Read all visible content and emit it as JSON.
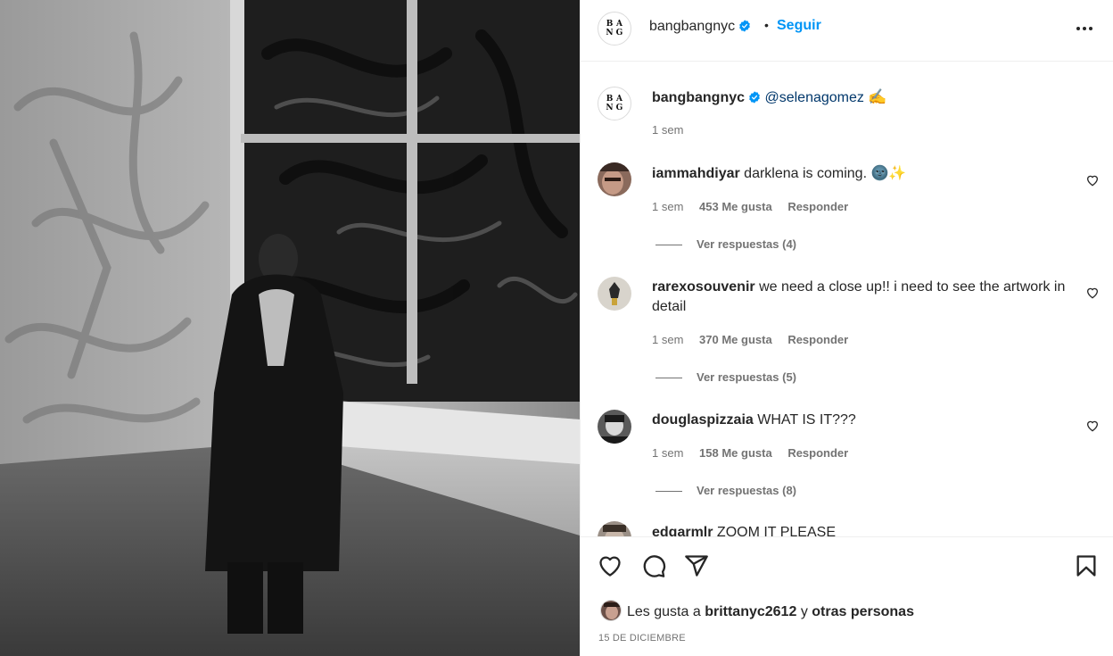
{
  "post": {
    "username": "bangbangnyc",
    "follow_label": "Seguir",
    "dot": "•",
    "logo_letters": [
      "B",
      "A",
      "N",
      "G"
    ],
    "photo_alt": "Black and white photo of a person in a long black coat standing in front of a graffiti-covered window"
  },
  "caption": {
    "username": "bangbangnyc",
    "mention": "@selenagomez",
    "emoji": "✍️",
    "time": "1 sem"
  },
  "comments": [
    {
      "username": "iammahdiyar",
      "text": "darklena is coming. 🌚✨",
      "time": "1 sem",
      "likes": "453 Me gusta",
      "reply": "Responder",
      "replies": "Ver respuestas (4)"
    },
    {
      "username": "rarexosouvenir",
      "text": "we need a close up!! i need to see the artwork in detail",
      "time": "1 sem",
      "likes": "370 Me gusta",
      "reply": "Responder",
      "replies": "Ver respuestas (5)"
    },
    {
      "username": "douglaspizzaia",
      "text": "WHAT IS IT???",
      "time": "1 sem",
      "likes": "158 Me gusta",
      "reply": "Responder",
      "replies": "Ver respuestas (8)"
    },
    {
      "username": "edgarmlr",
      "text": "ZOOM IT PLEASE"
    }
  ],
  "footer": {
    "likes_prefix": "Les gusta a",
    "liker": "brittanyc2612",
    "likes_join": "y",
    "likes_others": "otras personas",
    "date": "15 DE DICIEMBRE"
  },
  "icons": {
    "verified": "verified-badge-icon",
    "more": "more-options-icon",
    "like": "heart-icon",
    "comment": "comment-icon",
    "share": "share-icon",
    "save": "bookmark-icon"
  },
  "colors": {
    "link_blue": "#0095f6",
    "mention": "#00376b",
    "verified": "#0095f6",
    "secondary_text": "#737373",
    "primary_text": "#262626"
  }
}
